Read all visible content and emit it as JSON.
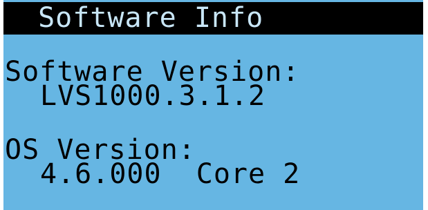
{
  "screen": {
    "title": " Software Info",
    "software_version_label": "Software Version:",
    "software_version_value": "LVS1000.3.1.2",
    "os_version_label": "OS Version:",
    "os_version_value": "4.6.000  Core 2"
  },
  "colors": {
    "background": "#66b6e3",
    "title_bar": "#000000",
    "title_text": "#c8e6f7",
    "text": "#000000"
  }
}
